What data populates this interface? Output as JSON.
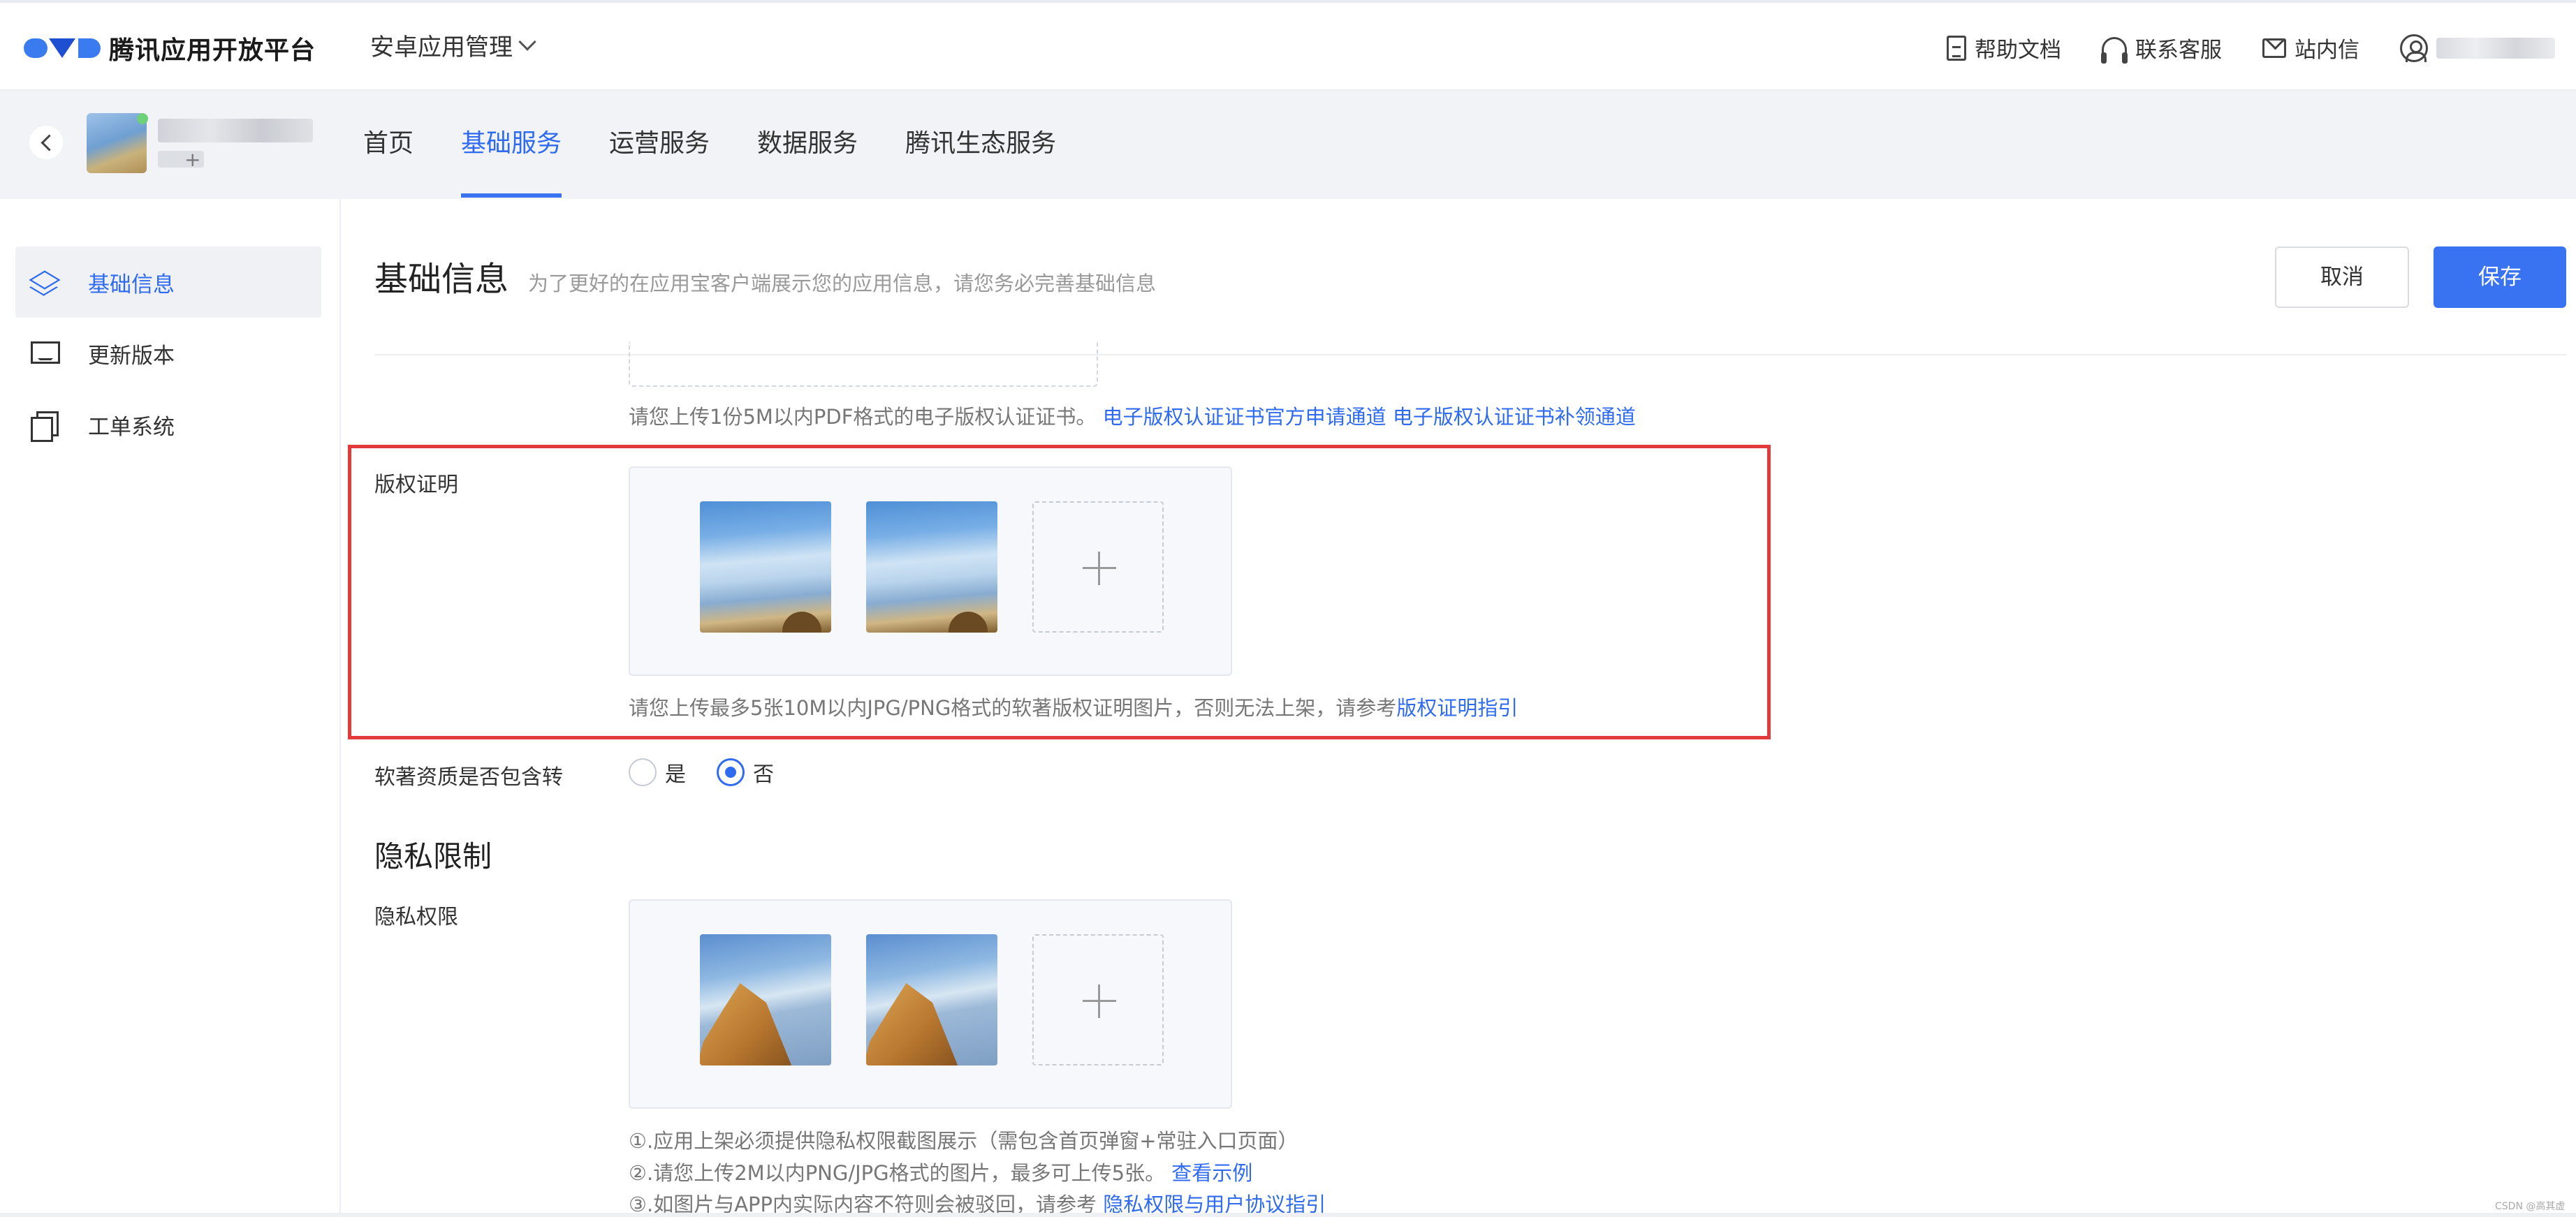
{
  "topbar": {
    "brand": "腾讯应用开放平台",
    "app_switch": "安卓应用管理",
    "links": [
      "帮助文档",
      "联系客服",
      "站内信"
    ]
  },
  "app_header": {
    "tabs": [
      "首页",
      "基础服务",
      "运营服务",
      "数据服务",
      "腾讯生态服务"
    ],
    "active_tab": "基础服务",
    "app_sub": "+"
  },
  "sidebar": {
    "items": [
      "基础信息",
      "更新版本",
      "工单系统"
    ],
    "active_item": "基础信息"
  },
  "content": {
    "title": "基础信息",
    "subtitle": "为了更好的在应用宝客户端展示您的应用信息，请您务必完善基础信息",
    "cancel": "取消",
    "save": "保存",
    "ecert_hint": "请您上传1份5M以内PDF格式的电子版权认证证书。",
    "ecert_link1": "电子版权认证证书官方申请通道",
    "ecert_link2": "电子版权认证证书补领通道",
    "copyright": {
      "label": "版权证明",
      "hint": "请您上传最多5张10M以内JPG/PNG格式的软著版权证明图片，否则无法上架，请参考",
      "hint_link": "版权证明指引",
      "images": [
        "sky",
        "sky"
      ]
    },
    "transfer": {
      "label": "软著资质是否包含转",
      "options": [
        "是",
        "否"
      ],
      "selected": "否"
    },
    "privacy": {
      "section_title": "隐私限制",
      "label": "隐私权限",
      "images": [
        "rock",
        "rock"
      ],
      "hint1": "①.应用上架必须提供隐私权限截图展示（需包含首页弹窗+常驻入口页面）",
      "hint2": "②.请您上传2M以内PNG/JPG格式的图片，最多可上传5张。",
      "hint2_link": "查看示例",
      "hint3": "③.如图片与APP内实际内容不符则会被驳回，请参考",
      "hint3_link": "隐私权限与用户协议指引"
    }
  },
  "watermark": "CSDN @高其虚",
  "colors": {
    "accent": "#3a73f2",
    "highlight_border": "#e33b3b"
  }
}
